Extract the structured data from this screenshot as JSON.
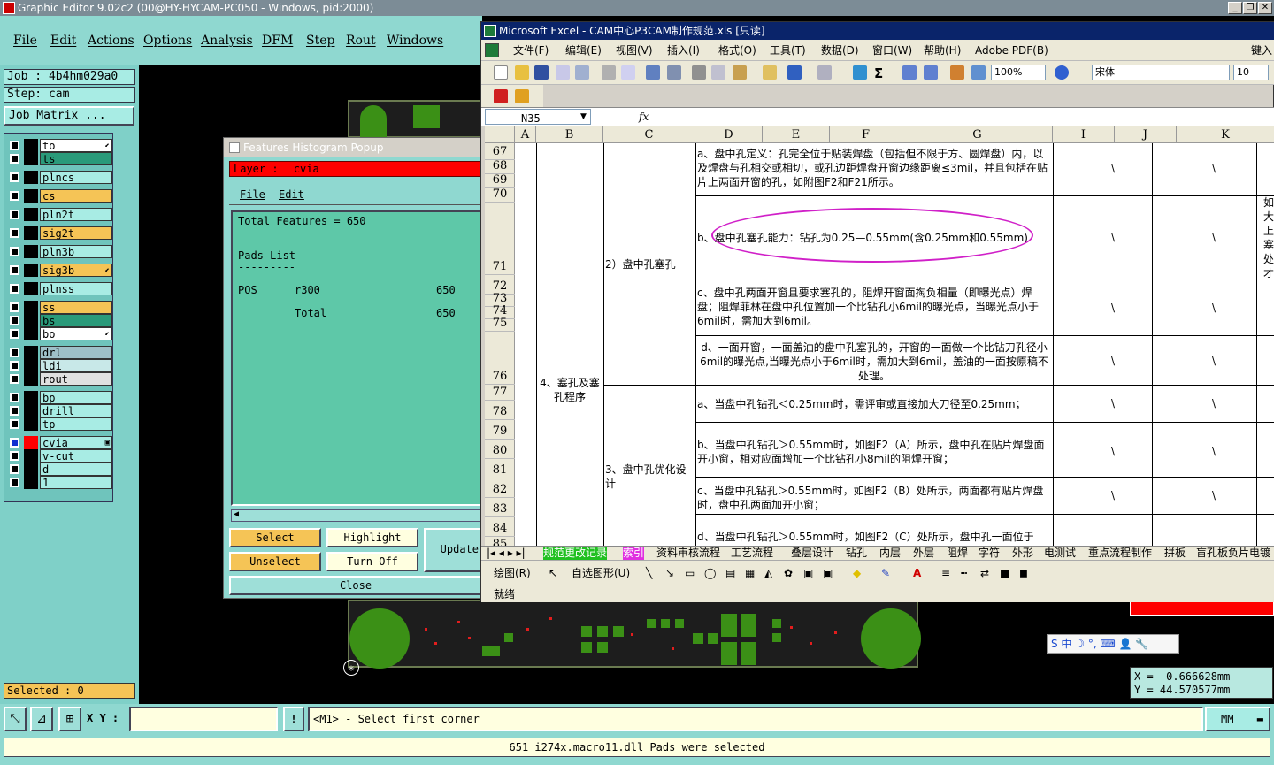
{
  "ge": {
    "title": "Graphic Editor 9.02c2 (00@HY-HYCAM-PC050 - Windows, pid:2000)",
    "menu": [
      "File",
      "Edit",
      "Actions",
      "Options",
      "Analysis",
      "DFM",
      "Step",
      "Rout",
      "Windows"
    ],
    "job": "Job : 4b4hm029a0",
    "step": "Step: cam",
    "job_matrix": "Job Matrix ...",
    "layers": [
      {
        "name": "to",
        "color": "#ffffff",
        "sw": "#000000",
        "mark": "⬋"
      },
      {
        "name": "ts",
        "color": "#2a9a7a",
        "sw": "#000000",
        "mark": ""
      },
      {
        "name": "plncs",
        "color": "#a8ece4",
        "sw": "#000000",
        "mark": ""
      },
      {
        "name": "cs",
        "color": "#f5c456",
        "sw": "#000000",
        "mark": ""
      },
      {
        "name": "pln2t",
        "color": "#a8ece4",
        "sw": "#000000",
        "mark": ""
      },
      {
        "name": "sig2t",
        "color": "#f5c456",
        "sw": "#000000",
        "mark": ""
      },
      {
        "name": "pln3b",
        "color": "#a8ece4",
        "sw": "#000000",
        "mark": ""
      },
      {
        "name": "sig3b",
        "color": "#f5c456",
        "sw": "#000000",
        "mark": "⬋"
      },
      {
        "name": "plnss",
        "color": "#a8ece4",
        "sw": "#000000",
        "mark": ""
      },
      {
        "name": "ss",
        "color": "#f5c456",
        "sw": "#000000",
        "mark": ""
      },
      {
        "name": "bs",
        "color": "#2a9a7a",
        "sw": "#000000",
        "mark": ""
      },
      {
        "name": "bo",
        "color": "#ffffff",
        "sw": "#000000",
        "mark": "⬋"
      },
      {
        "name": "drl",
        "color": "#9ec0c8",
        "sw": "#000000",
        "mark": ""
      },
      {
        "name": "ldi",
        "color": "#c8e8e8",
        "sw": "#000000",
        "mark": ""
      },
      {
        "name": "rout",
        "color": "#e0e0e0",
        "sw": "#000000",
        "mark": ""
      },
      {
        "name": "bp",
        "color": "#a8ece4",
        "sw": "#000000",
        "mark": ""
      },
      {
        "name": "drill",
        "color": "#a8ece4",
        "sw": "#000000",
        "mark": ""
      },
      {
        "name": "tp",
        "color": "#a8ece4",
        "sw": "#000000",
        "mark": ""
      },
      {
        "name": "cvia",
        "color": "#a8ece4",
        "sw": "#ff0000",
        "mark": "▣"
      },
      {
        "name": "v-cut",
        "color": "#a8ece4",
        "sw": "#000000",
        "mark": ""
      },
      {
        "name": "d",
        "color": "#a8ece4",
        "sw": "#000000",
        "mark": ""
      },
      {
        "name": "1",
        "color": "#a8ece4",
        "sw": "#000000",
        "mark": ""
      }
    ],
    "selected": "Selected : 0",
    "xy_label": "X Y :",
    "xy_value": "",
    "prompt": "<M1> - Select first corner",
    "unit": "MM",
    "status": "651 i274x.macro11.dll Pads were selected",
    "coord_x": "X = -0.666628mm",
    "coord_y": "Y = 44.570577mm",
    "ime": "S 中 ☽ °, ⌨ 👤 🔧"
  },
  "hist": {
    "title": "Features Histogram Popup",
    "layer_label": "Layer :",
    "layer_value": "cvia",
    "menu": [
      "File",
      "Edit"
    ],
    "total": "Total Features = 650",
    "pads_list": "Pads List",
    "pads_sep": "---------",
    "row_type": "POS",
    "row_sym": "r300",
    "row_count": "650",
    "sep_line": "-----------------------------------------",
    "total_label": "Total",
    "total_count": "650",
    "btn_select": "Select",
    "btn_highlight": "Highlight",
    "btn_update": "Update",
    "btn_unselect": "Unselect",
    "btn_turnoff": "Turn Off",
    "btn_close": "Close"
  },
  "xl": {
    "title": "Microsoft Excel - CAM中心P3CAM制作规范.xls [只读]",
    "menu": [
      "文件(F)",
      "编辑(E)",
      "视图(V)",
      "插入(I)",
      "格式(O)",
      "工具(T)",
      "数据(D)",
      "窗口(W)",
      "帮助(H)",
      "Adobe PDF(B)"
    ],
    "help_box": "键入",
    "zoom": "100%",
    "font": "宋体",
    "size": "10",
    "namebox": "N35",
    "fx": "fx",
    "columns": [
      "A",
      "B",
      "C",
      "D",
      "E",
      "F",
      "G",
      "I",
      "J",
      "K"
    ],
    "rows": [
      "67",
      "68",
      "69",
      "70",
      "71",
      "72",
      "73",
      "74",
      "75",
      "76",
      "77",
      "78",
      "79",
      "80",
      "81",
      "82",
      "83",
      "84",
      "85"
    ],
    "b_merged": "4、塞孔及塞孔程序",
    "c2": "2）盘中孔塞孔",
    "c3": "3、盘中孔优化设计",
    "text_a": "a、盘中孔定义：孔完全位于贴装焊盘（包括但不限于方、圆焊盘）内，以及焊盘与孔相交或相切，或孔边距焊盘开窗边缘距离≤3mil，并且包括在贴片上两面开窗的孔，如附图F2和F21所示。",
    "text_b": "b、盘中孔塞孔能力：钻孔为0.25—0.55mm(含0.25mm和0.55mm)",
    "text_c": "c、盘中孔两面开窗且要求塞孔的，阻焊开窗面掏负相量（即曝光点）焊盘；阻焊菲林在盘中孔位置加一个比钻孔小6mil的曝光点，当曝光点小于6mil时，需加大到6mil。",
    "text_d": "d、一面开窗，一面盖油的盘中孔塞孔的，开窗的一面做一个比钻刀孔径小6mil的曝光点,当曝光点小于6mil时，需加大到6mil，盖油的一面按原稿不处理。",
    "text_e": "a、当盘中孔钻孔＜0.25mm时，需评审或直接加大刀径至0.25mm；",
    "text_f": "b、当盘中孔钻孔＞0.55mm时，如图F2（A）所示，盘中孔在贴片焊盘面开小窗，相对应面增加一个比钻孔小8mil的阻焊开窗；",
    "text_g": "c、当盘中孔钻孔＞0.55mm时，如图F2（B）处所示，两面都有贴片焊盘时，盘中孔两面加开小窗；",
    "text_h": "d、当盘中孔钻孔＞0.55mm时，如图F2（C）处所示，盘中孔一面位于",
    "backslash": "\\",
    "right_col": [
      "如",
      "大",
      "上",
      "塞",
      "处",
      "才"
    ],
    "tabs": [
      "规范更改记录",
      "索引",
      "资料审核流程",
      "工艺流程",
      "叠层设计",
      "钻孔",
      "内层",
      "外层",
      "阻焊",
      "字符",
      "外形",
      "电测试",
      "重点流程制作",
      "拼板",
      "盲孔板负片电镀"
    ],
    "draw_label": "绘图(R)",
    "autoshape": "自选图形(U)",
    "status": "就绪"
  }
}
